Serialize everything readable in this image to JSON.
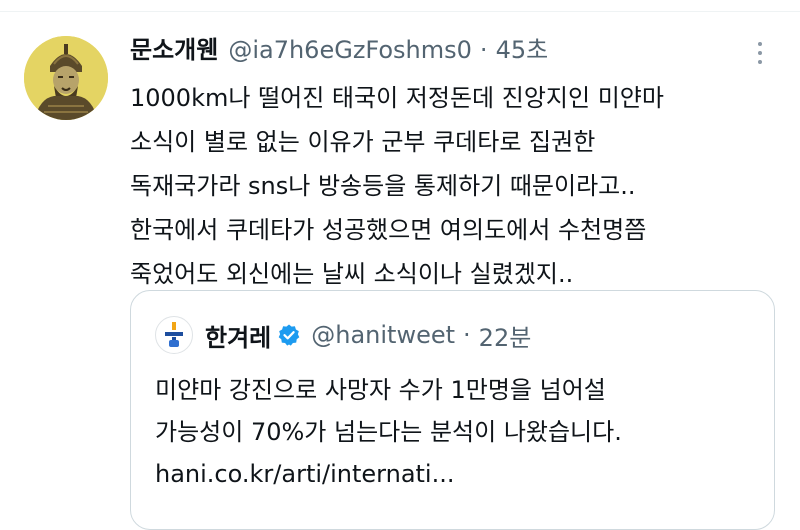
{
  "tweet": {
    "author": {
      "display_name": "문소개웬",
      "handle": "@ia7h6eGzFoshms0",
      "time": "45초",
      "avatar_icon": "warrior-portrait-avatar"
    },
    "more_icon": "more-vertical-icon",
    "body_lines": [
      "1000km나 떨어진 태국이 저정돈데 진앙지인 미얀마",
      "소식이 별로 없는 이유가 군부 쿠데타로 집권한",
      "독재국가라 sns나 방송등을 통제하기 때문이라고..",
      "한국에서 쿠데타가 성공했으면 여의도에서 수천명쯤",
      "죽었어도 외신에는 날씨 소식이나 실렸겠지.."
    ]
  },
  "quote": {
    "author": {
      "display_name": "한겨레",
      "handle": "@hanitweet",
      "time": "22분",
      "verified_icon": "verified-badge-icon",
      "verified_color": "#1d9bf0"
    },
    "body_lines": [
      "미얀마 강진으로 사망자 수가 1만명을 넘어설",
      "가능성이 70%가 넘는다는 분석이 나왔습니다.",
      "hani.co.kr/arti/internati..."
    ]
  },
  "dot_separator": "·"
}
